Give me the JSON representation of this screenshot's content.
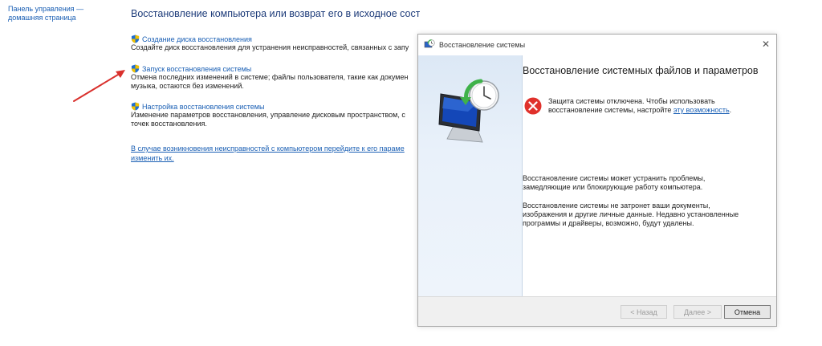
{
  "nav": {
    "home_line1": "Панель управления —",
    "home_line2": "домашняя страница"
  },
  "main": {
    "title": "Восстановление компьютера или возврат его в исходное состояние",
    "tasks": [
      {
        "link": "Создание диска восстановления",
        "desc_lines": [
          "Создайте диск восстановления для устранения неисправностей, связанных с запу"
        ]
      },
      {
        "link": "Запуск восстановления системы",
        "desc_lines": [
          "Отмена последних изменений в системе; файлы пользователя, такие как докумен",
          "музыка, остаются без изменений."
        ]
      },
      {
        "link": "Настройка восстановления системы",
        "desc_lines": [
          "Изменение параметров восстановления, управление дисковым пространством, с",
          "точек восстановления."
        ]
      }
    ],
    "bottom_link_lines": [
      "В случае возникновения неисправностей с компьютером перейдите к его параме",
      "изменить их."
    ]
  },
  "dialog": {
    "title": "Восстановление системы",
    "close_glyph": "✕",
    "heading": "Восстановление системных файлов и параметров",
    "warning_text": "Защита системы отключена. Чтобы использовать восстановление системы, настройте ",
    "warning_link": "эту возможность",
    "warning_end": ".",
    "para1": "Восстановление системы может устранить проблемы, замедляющие или блокирующие работу компьютера.",
    "para2": "Восстановление системы не затронет ваши документы, изображения и другие личные данные. Недавно установленные программы и драйверы, возможно, будут удалены.",
    "buttons": {
      "back": "< Назад",
      "next": "Далее >",
      "cancel": "Отмена"
    }
  },
  "colors": {
    "link": "#1a5fb4",
    "title": "#1e3c7a",
    "arrow": "#d9302c",
    "error": "#e0312b"
  },
  "icons": {
    "shield": "uac-shield-icon",
    "error": "error-icon",
    "hero": "system-restore-icon"
  }
}
